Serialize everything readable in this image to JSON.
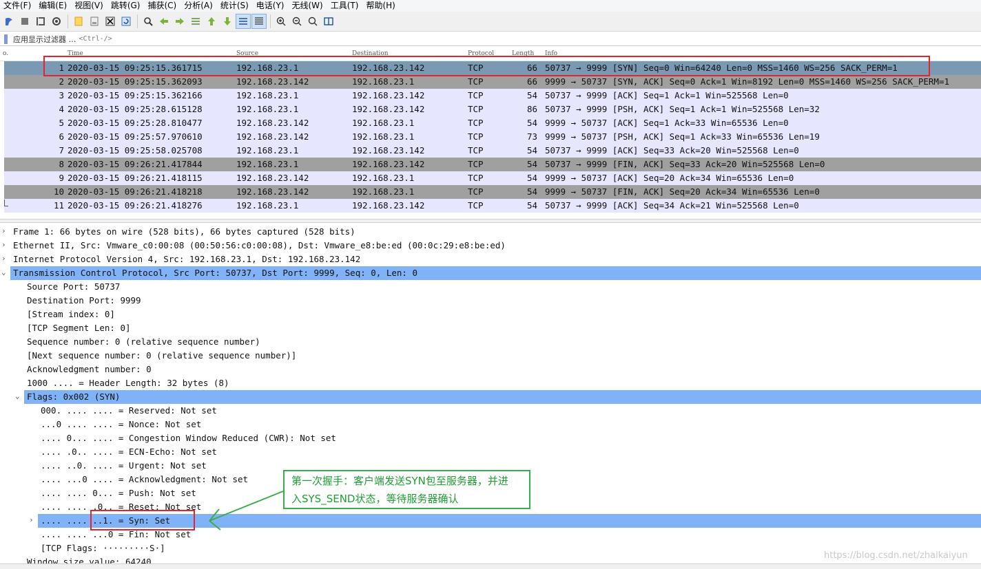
{
  "menu": [
    "文件(F)",
    "编辑(E)",
    "视图(V)",
    "跳转(G)",
    "捕获(C)",
    "分析(A)",
    "统计(S)",
    "电话(Y)",
    "无线(W)",
    "工具(T)",
    "帮助(H)"
  ],
  "filter": {
    "label": "应用显示过滤器 …",
    "hint": "<Ctrl-/>"
  },
  "packet_list": {
    "columns": [
      "o.",
      "Time",
      "Source",
      "Destination",
      "Protocol",
      "Length",
      "Info"
    ],
    "rows": [
      {
        "no": "1",
        "time": "2020-03-15 09:25:15.361715",
        "src": "192.168.23.1",
        "dst": "192.168.23.142",
        "proto": "TCP",
        "len": "66",
        "info": "50737 → 9999 [SYN] Seq=0 Win=64240 Len=0 MSS=1460 WS=256 SACK_PERM=1",
        "style": "sel"
      },
      {
        "no": "2",
        "time": "2020-03-15 09:25:15.362093",
        "src": "192.168.23.142",
        "dst": "192.168.23.1",
        "proto": "TCP",
        "len": "66",
        "info": "9999 → 50737 [SYN, ACK] Seq=0 Ack=1 Win=8192 Len=0 MSS=1460 WS=256 SACK_PERM=1",
        "style": "dark"
      },
      {
        "no": "3",
        "time": "2020-03-15 09:25:15.362166",
        "src": "192.168.23.1",
        "dst": "192.168.23.142",
        "proto": "TCP",
        "len": "54",
        "info": "50737 → 9999 [ACK] Seq=1 Ack=1 Win=525568 Len=0",
        "style": "light"
      },
      {
        "no": "4",
        "time": "2020-03-15 09:25:28.615128",
        "src": "192.168.23.1",
        "dst": "192.168.23.142",
        "proto": "TCP",
        "len": "86",
        "info": "50737 → 9999 [PSH, ACK] Seq=1 Ack=1 Win=525568 Len=32",
        "style": "light"
      },
      {
        "no": "5",
        "time": "2020-03-15 09:25:28.810477",
        "src": "192.168.23.142",
        "dst": "192.168.23.1",
        "proto": "TCP",
        "len": "54",
        "info": "9999 → 50737 [ACK] Seq=1 Ack=33 Win=65536 Len=0",
        "style": "light"
      },
      {
        "no": "6",
        "time": "2020-03-15 09:25:57.970610",
        "src": "192.168.23.142",
        "dst": "192.168.23.1",
        "proto": "TCP",
        "len": "73",
        "info": "9999 → 50737 [PSH, ACK] Seq=1 Ack=33 Win=65536 Len=19",
        "style": "light"
      },
      {
        "no": "7",
        "time": "2020-03-15 09:25:58.025708",
        "src": "192.168.23.1",
        "dst": "192.168.23.142",
        "proto": "TCP",
        "len": "54",
        "info": "50737 → 9999 [ACK] Seq=33 Ack=20 Win=525568 Len=0",
        "style": "light"
      },
      {
        "no": "8",
        "time": "2020-03-15 09:26:21.417844",
        "src": "192.168.23.1",
        "dst": "192.168.23.142",
        "proto": "TCP",
        "len": "54",
        "info": "50737 → 9999 [FIN, ACK] Seq=33 Ack=20 Win=525568 Len=0",
        "style": "dark"
      },
      {
        "no": "9",
        "time": "2020-03-15 09:26:21.418115",
        "src": "192.168.23.142",
        "dst": "192.168.23.1",
        "proto": "TCP",
        "len": "54",
        "info": "9999 → 50737 [ACK] Seq=20 Ack=34 Win=65536 Len=0",
        "style": "light"
      },
      {
        "no": "10",
        "time": "2020-03-15 09:26:21.418218",
        "src": "192.168.23.142",
        "dst": "192.168.23.1",
        "proto": "TCP",
        "len": "54",
        "info": "9999 → 50737 [FIN, ACK] Seq=20 Ack=34 Win=65536 Len=0",
        "style": "dark"
      },
      {
        "no": "11",
        "time": "2020-03-15 09:26:21.418276",
        "src": "192.168.23.1",
        "dst": "192.168.23.142",
        "proto": "TCP",
        "len": "54",
        "info": "50737 → 9999 [ACK] Seq=34 Ack=21 Win=525568 Len=0",
        "style": "light"
      }
    ]
  },
  "details": [
    {
      "text": "Frame 1: 66 bytes on wire (528 bits), 66 bytes captured (528 bits)",
      "level": 0,
      "arrow": "›"
    },
    {
      "text": "Ethernet II, Src: Vmware_c0:00:08 (00:50:56:c0:00:08), Dst: Vmware_e8:be:ed (00:0c:29:e8:be:ed)",
      "level": 0,
      "arrow": "›"
    },
    {
      "text": "Internet Protocol Version 4, Src: 192.168.23.1, Dst: 192.168.23.142",
      "level": 0,
      "arrow": "›"
    },
    {
      "text": "Transmission Control Protocol, Src Port: 50737, Dst Port: 9999, Seq: 0, Len: 0",
      "level": 0,
      "arrow": "⌄",
      "selected": true
    },
    {
      "text": "Source Port: 50737",
      "level": 1
    },
    {
      "text": "Destination Port: 9999",
      "level": 1
    },
    {
      "text": "[Stream index: 0]",
      "level": 1
    },
    {
      "text": "[TCP Segment Len: 0]",
      "level": 1
    },
    {
      "text": "Sequence number: 0    (relative sequence number)",
      "level": 1
    },
    {
      "text": "[Next sequence number: 0    (relative sequence number)]",
      "level": 1
    },
    {
      "text": "Acknowledgment number: 0",
      "level": 1
    },
    {
      "text": "1000 .... = Header Length: 32 bytes (8)",
      "level": 1
    },
    {
      "text": "Flags: 0x002 (SYN)",
      "level": 1,
      "arrow": "⌄",
      "selected": true
    },
    {
      "text": "000. .... .... = Reserved: Not set",
      "level": 2
    },
    {
      "text": "...0 .... .... = Nonce: Not set",
      "level": 2
    },
    {
      "text": ".... 0... .... = Congestion Window Reduced (CWR): Not set",
      "level": 2
    },
    {
      "text": ".... .0.. .... = ECN-Echo: Not set",
      "level": 2
    },
    {
      "text": ".... ..0. .... = Urgent: Not set",
      "level": 2
    },
    {
      "text": ".... ...0 .... = Acknowledgment: Not set",
      "level": 2
    },
    {
      "text": ".... .... 0... = Push: Not set",
      "level": 2
    },
    {
      "text": ".... .... .0.. = Reset: Not set",
      "level": 2
    },
    {
      "text": ".... .... ..1. = Syn: Set",
      "level": 2,
      "arrow": "›",
      "selected": true
    },
    {
      "text": ".... .... ...0 = Fin: Not set",
      "level": 2
    },
    {
      "text": "[TCP Flags: ·········S·]",
      "level": 2
    },
    {
      "text": "Window size value: 64240",
      "level": 1
    }
  ],
  "annotation": {
    "line1": "第一次握手：客户端发送SYN包至服务器，并进",
    "line2": "入SYS_SEND状态，等待服务器确认"
  },
  "watermark": "https://blog.csdn.net/zhaikaiyun",
  "colors": {
    "row_light": "#e7e6ff",
    "row_dark": "#a0a0a0",
    "row_selected": "#7a99b3",
    "tree_selected": "#7fb2f7",
    "highlight_red": "#e8222a",
    "callout_green": "#3aae4a"
  },
  "toolbar_icons": [
    "shark-fin-start-icon",
    "stop-capture-icon",
    "restart-capture-icon",
    "capture-options-icon",
    "open-file-icon",
    "save-file-icon",
    "close-file-icon",
    "reload-file-icon",
    "find-packet-icon",
    "go-back-icon",
    "go-forward-icon",
    "go-to-packet-icon",
    "first-packet-icon",
    "last-packet-icon",
    "auto-scroll-icon",
    "colorize-icon",
    "zoom-in-icon",
    "zoom-out-icon",
    "normal-size-icon",
    "resize-columns-icon"
  ]
}
